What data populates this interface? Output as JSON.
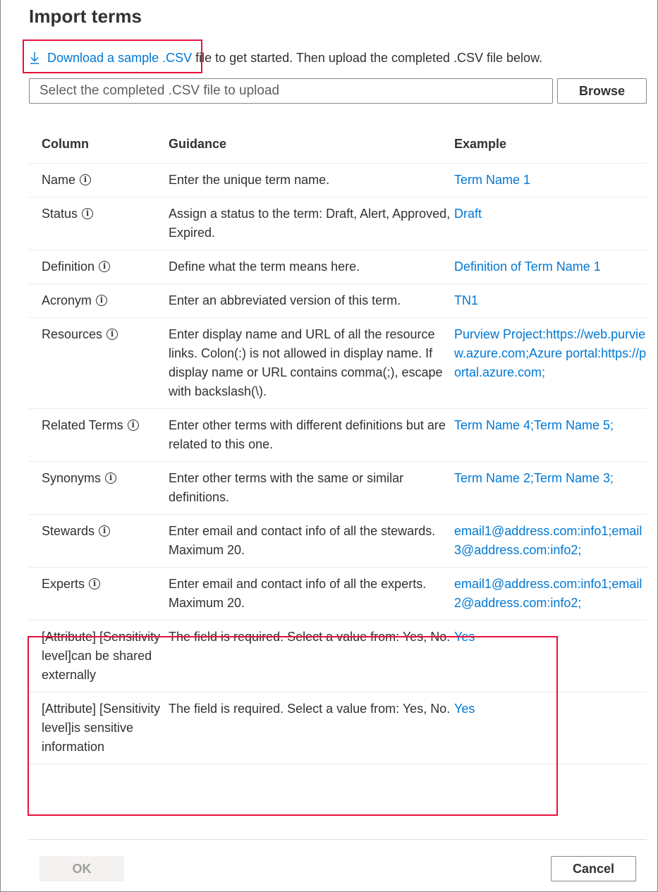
{
  "dialog": {
    "title": "Import terms",
    "download_link": "Download a sample .CSV",
    "download_suffix": " file to get started. Then upload the completed .CSV file below.",
    "file_placeholder": "Select the completed .CSV file to upload",
    "browse_label": "Browse",
    "ok_label": "OK",
    "cancel_label": "Cancel"
  },
  "table": {
    "headers": [
      "Column",
      "Guidance",
      "Example"
    ],
    "rows": [
      {
        "column": "Name",
        "guidance": "Enter the unique term name.",
        "example": "Term Name 1",
        "info": true
      },
      {
        "column": "Status",
        "guidance": "Assign a status to the term: Draft, Alert, Approved, Expired.",
        "example": "Draft",
        "info": true
      },
      {
        "column": "Definition",
        "guidance": "Define what the term means here.",
        "example": "Definition of Term Name 1",
        "info": true
      },
      {
        "column": "Acronym",
        "guidance": "Enter an abbreviated version of this term.",
        "example": "TN1",
        "info": true
      },
      {
        "column": "Resources",
        "guidance": "Enter display name and URL of all the resource links. Colon(:) is not allowed in display name. If display name or URL contains comma(;), escape with backslash(\\).",
        "example": "Purview Project:https://web.purview.azure.com;Azure portal:https://portal.azure.com;",
        "info": true
      },
      {
        "column": "Related Terms",
        "guidance": "Enter other terms with different definitions but are related to this one.",
        "example": "Term Name 4;Term Name 5;",
        "info": true
      },
      {
        "column": "Synonyms",
        "guidance": "Enter other terms with the same or similar definitions.",
        "example": "Term Name 2;Term Name 3;",
        "info": true
      },
      {
        "column": "Stewards",
        "guidance": "Enter email and contact info of all the stewards. Maximum 20.",
        "example": "email1@address.com:info1;email3@address.com:info2;",
        "info": true
      },
      {
        "column": "Experts",
        "guidance": "Enter email and contact info of all the experts. Maximum 20.",
        "example": "email1@address.com:info1;email2@address.com:info2;",
        "info": true
      },
      {
        "column": "[Attribute] [Sensitivity level]can be shared externally",
        "guidance": "The field is required. Select a value from: Yes, No.",
        "example": "Yes",
        "info": false
      },
      {
        "column": "[Attribute] [Sensitivity level]is sensitive information",
        "guidance": "The field is required. Select a value from: Yes, No.",
        "example": "Yes",
        "info": false
      }
    ]
  },
  "icons": {
    "download": "download-arrow-icon",
    "info": "info-circle-icon",
    "info_glyph": "i"
  },
  "colors": {
    "link": "#0078d4",
    "highlight": "#e8103a",
    "text": "#323130",
    "disabled_bg": "#f3f2f1"
  }
}
